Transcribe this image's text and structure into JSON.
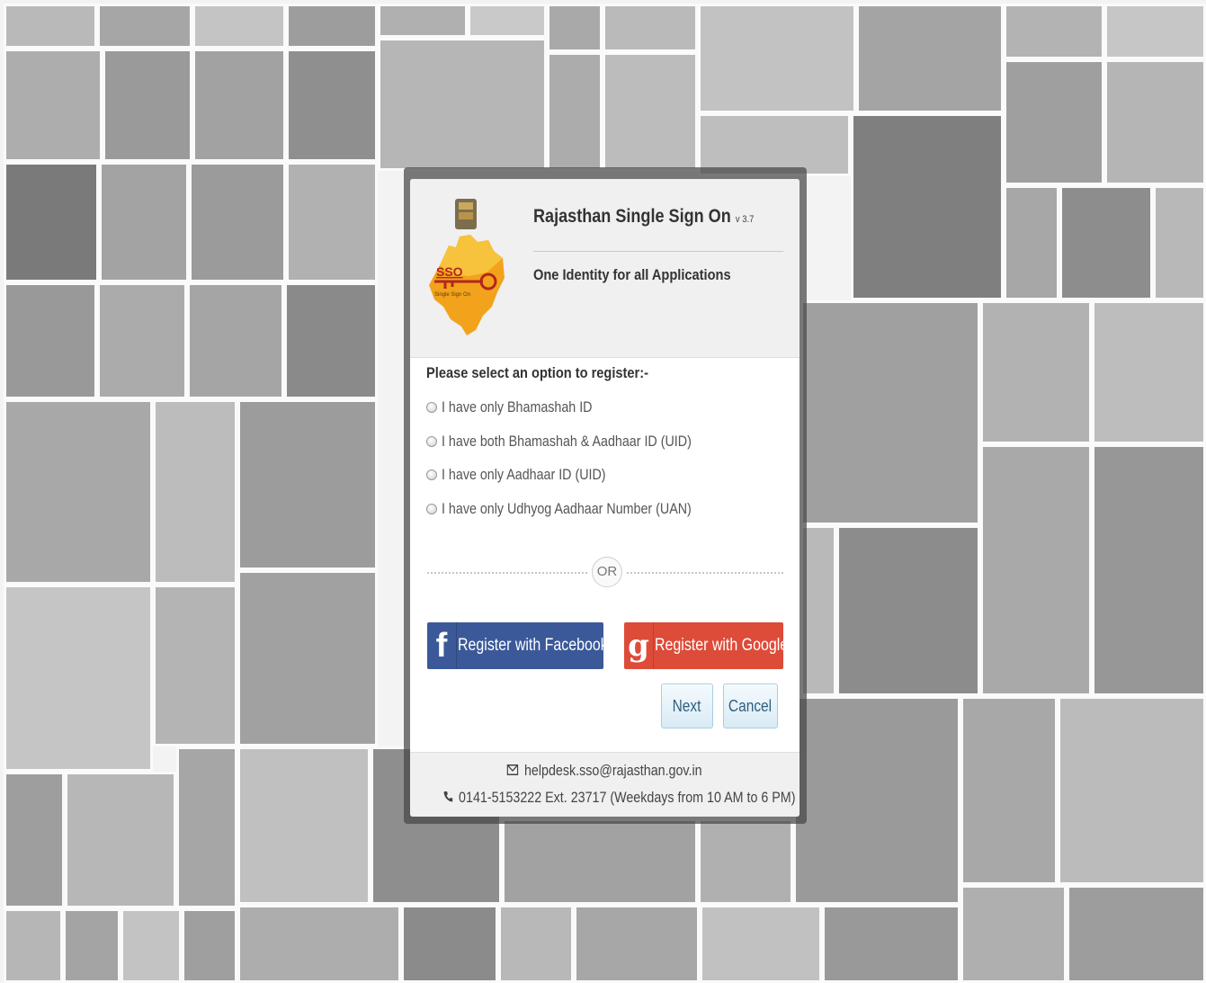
{
  "header": {
    "title": "Rajasthan Single Sign On",
    "version": "v 3.7",
    "tagline": "One Identity for all Applications",
    "logo_text": "SSO",
    "logo_subtext": "Single Sign On"
  },
  "register": {
    "prompt": "Please select an option to register:-",
    "options": [
      {
        "label": "I have only Bhamashah ID"
      },
      {
        "label": "I have both Bhamashah & Aadhaar ID (UID)"
      },
      {
        "label": "I have only Aadhaar ID (UID)"
      },
      {
        "label": "I have only Udhyog Aadhaar Number (UAN)"
      }
    ],
    "or_label": "OR"
  },
  "social": {
    "facebook_label": "Register with Facebook",
    "facebook_icon": "f",
    "google_label": "Register with Google",
    "google_icon": "g"
  },
  "actions": {
    "next_label": "Next",
    "cancel_label": "Cancel"
  },
  "footer": {
    "email": "helpdesk.sso@rajasthan.gov.in",
    "phone": "0141-5153222 Ext. 23717  (Weekdays from 10 AM to 6 PM)"
  },
  "colors": {
    "facebook": "#3b5998",
    "google": "#dd4b39",
    "background": "#e9e9e9",
    "logo_orange": "#f2a31b"
  },
  "icons": [
    "envelope-icon",
    "phone-icon",
    "facebook-icon",
    "google-plus-icon",
    "sso-key-logo"
  ]
}
